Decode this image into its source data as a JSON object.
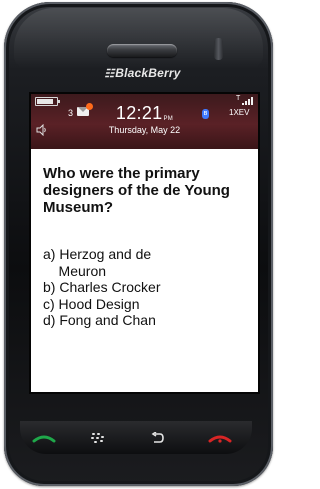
{
  "device": {
    "brand": "BlackBerry",
    "brand_logo": "☷"
  },
  "statusbar": {
    "battery_level": 0.85,
    "notification_count": "3",
    "mail_icon": "envelope-icon",
    "time": "12:21",
    "time_suffix": "PM",
    "date": "Thursday, May 22",
    "bluetooth_icon": "bluetooth-icon",
    "bluetooth_glyph": "ʙ",
    "signal_label": "T",
    "signal_icon": "signal-bars-icon",
    "network_type": "1XEV",
    "sound_icon": "speaker-icon"
  },
  "quiz": {
    "question": "Who were the primary designers of the de Young Museum?",
    "answers": [
      "a) Herzog and de\n    Meuron",
      "b) Charles Crocker",
      "c) Hood Design",
      "d) Fong and Chan"
    ]
  },
  "keys": {
    "send": "phone-call-icon",
    "menu": "blackberry-menu-icon",
    "back": "back-arrow-icon",
    "end": "end-call-icon"
  },
  "colors": {
    "statusbar_bg": "#5a2126",
    "send_green": "#1fa84a",
    "end_red": "#d82525"
  }
}
